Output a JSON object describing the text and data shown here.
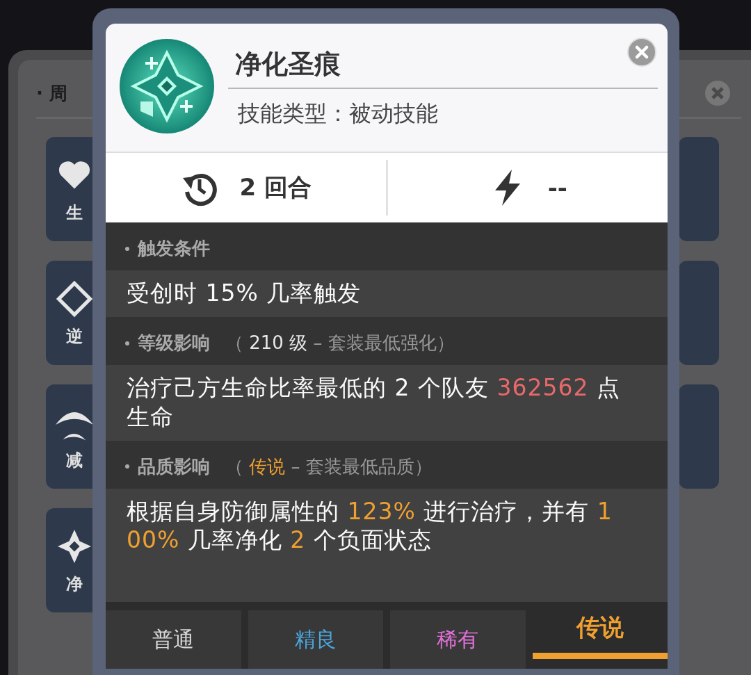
{
  "background": {
    "title": "· 周",
    "cards": [
      {
        "label": "生"
      },
      {
        "label": "逆"
      },
      {
        "label": "减"
      },
      {
        "label": "净"
      }
    ]
  },
  "skill": {
    "name": "净化圣痕",
    "type": "技能类型：被动技能"
  },
  "stats": [
    {
      "kind": "cooldown",
      "value": "2 回合"
    },
    {
      "kind": "energy",
      "value": "--"
    }
  ],
  "sections": [
    {
      "title": "触发条件",
      "description": [
        {
          "text": "受创时 15% 几率触发"
        }
      ]
    },
    {
      "title": "等级影响",
      "note": [
        {
          "text": "（ "
        },
        {
          "text": "210 级",
          "color": "#e8e8e8"
        },
        {
          "text": " – 套装最低强化）"
        }
      ],
      "description": [
        {
          "text": "治疗己方生命比率最低的 2 个队友 "
        },
        {
          "text": "362562",
          "color": "#e8696a"
        },
        {
          "text": " 点生命"
        }
      ]
    },
    {
      "title": "品质影响",
      "note": [
        {
          "text": "（ "
        },
        {
          "text": "传说",
          "color": "#f0a030"
        },
        {
          "text": " – 套装最低品质）"
        }
      ],
      "description": [
        {
          "text": "根据自身防御属性的 "
        },
        {
          "text": "123%",
          "color": "#f0a030"
        },
        {
          "text": " 进行治疗，并有 "
        },
        {
          "text": "100%",
          "color": "#f0a030"
        },
        {
          "text": " 几率净化 "
        },
        {
          "text": "2",
          "color": "#f0a030"
        },
        {
          "text": " 个负面状态"
        }
      ]
    }
  ],
  "tabs": [
    {
      "label": "普通",
      "selected": false
    },
    {
      "label": "精良",
      "color": "#4aa8e0",
      "selected": false
    },
    {
      "label": "稀有",
      "color": "#e070d8",
      "selected": false
    },
    {
      "label": "传说",
      "color": "#f0a030",
      "selected": true
    }
  ]
}
